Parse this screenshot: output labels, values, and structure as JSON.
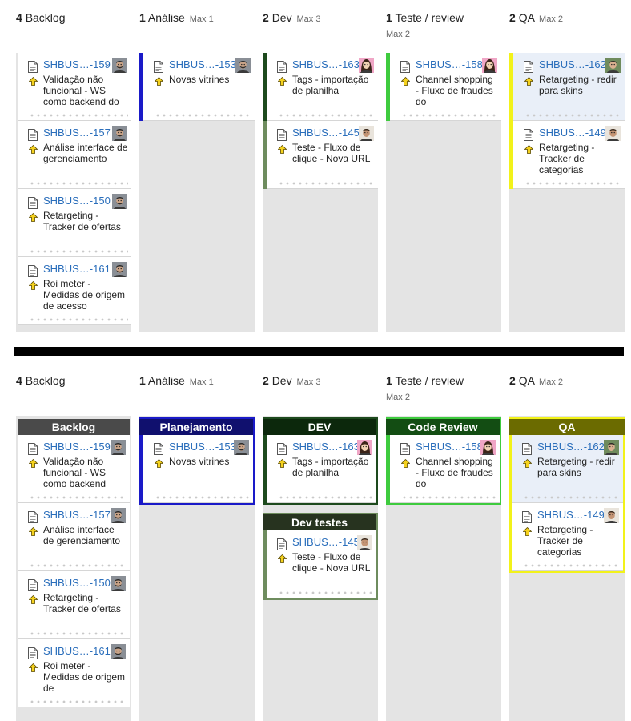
{
  "top": {
    "columns": [
      {
        "count": "4",
        "name": "Backlog",
        "max": ""
      },
      {
        "count": "1",
        "name": "Análise",
        "max": "Max 1"
      },
      {
        "count": "2",
        "name": "Dev",
        "max": "Max 3"
      },
      {
        "count": "1",
        "name": "Teste / review",
        "max": "Max 2"
      },
      {
        "count": "2",
        "name": "QA",
        "max": "Max 2"
      }
    ],
    "cards": {
      "c0": {
        "key": "SHBUS…-159",
        "summary": "Validação não funcional - WS como backend do"
      },
      "c1": {
        "key": "SHBUS…-157",
        "summary": "Análise interface de gerenciamento"
      },
      "c2": {
        "key": "SHBUS…-150",
        "summary": "Retargeting - Tracker de ofertas"
      },
      "c3": {
        "key": "SHBUS…-161",
        "summary": "Roi meter - Medidas de origem de acesso"
      },
      "c4": {
        "key": "SHBUS…-153",
        "summary": "Novas vitrines"
      },
      "c5": {
        "key": "SHBUS…-163",
        "summary": "Tags - importação de planilha"
      },
      "c6": {
        "key": "SHBUS…-145",
        "summary": "Teste - Fluxo de clique - Nova URL"
      },
      "c7": {
        "key": "SHBUS…-158",
        "summary": "Channel shopping - Fluxo de fraudes do"
      },
      "c8": {
        "key": "SHBUS…-162",
        "summary": "Retargeting - redir para skins"
      },
      "c9": {
        "key": "SHBUS…-149",
        "summary": "Retargeting - Tracker de categorias"
      }
    }
  },
  "bottom": {
    "columns": [
      {
        "count": "4",
        "name": "Backlog",
        "max": ""
      },
      {
        "count": "1",
        "name": "Análise",
        "max": "Max 1"
      },
      {
        "count": "2",
        "name": "Dev",
        "max": "Max 3"
      },
      {
        "count": "1",
        "name": "Teste / review",
        "max": "Max 2"
      },
      {
        "count": "2",
        "name": "QA",
        "max": "Max 2"
      }
    ],
    "groups": {
      "backlog": "Backlog",
      "planejamento": "Planejamento",
      "dev": "DEV",
      "devtestes": "Dev testes",
      "codereview": "Code Review",
      "qa": "QA"
    },
    "cards": {
      "c0": {
        "key": "SHBUS…-159",
        "summary": "Validação não funcional - WS como backend"
      },
      "c1": {
        "key": "SHBUS…-157",
        "summary": "Análise interface de gerenciamento"
      },
      "c2": {
        "key": "SHBUS…-150",
        "summary": "Retargeting - Tracker de ofertas"
      },
      "c3": {
        "key": "SHBUS…-161",
        "summary": "Roi meter - Medidas de origem de"
      },
      "c4": {
        "key": "SHBUS…-153",
        "summary": "Novas vitrines"
      },
      "c5": {
        "key": "SHBUS…-163",
        "summary": "Tags - importação de planilha"
      },
      "c6": {
        "key": "SHBUS…-145",
        "summary": "Teste - Fluxo de clique - Nova URL"
      },
      "c7": {
        "key": "SHBUS…-158",
        "summary": "Channel shopping - Fluxo de fraudes do"
      },
      "c8": {
        "key": "SHBUS…-162",
        "summary": "Retargeting - redir para skins"
      },
      "c9": {
        "key": "SHBUS…-149",
        "summary": "Retargeting - Tracker de categorias"
      }
    }
  },
  "colors": {
    "backlog": "#4a4a4a",
    "planejamento": "#1a1ac8",
    "dev": "#1d4a1d",
    "devtestes": "#6e8c5e",
    "codereview": "#3ecb3e",
    "qa": "#f2f21a",
    "qa_header": "#6b6b00",
    "link": "#2a6ebb"
  },
  "icons": {
    "document": "document-icon",
    "priority": "priority-up-arrow-icon",
    "avatar_man": "avatar-man-icon",
    "avatar_woman": "avatar-woman-icon"
  }
}
